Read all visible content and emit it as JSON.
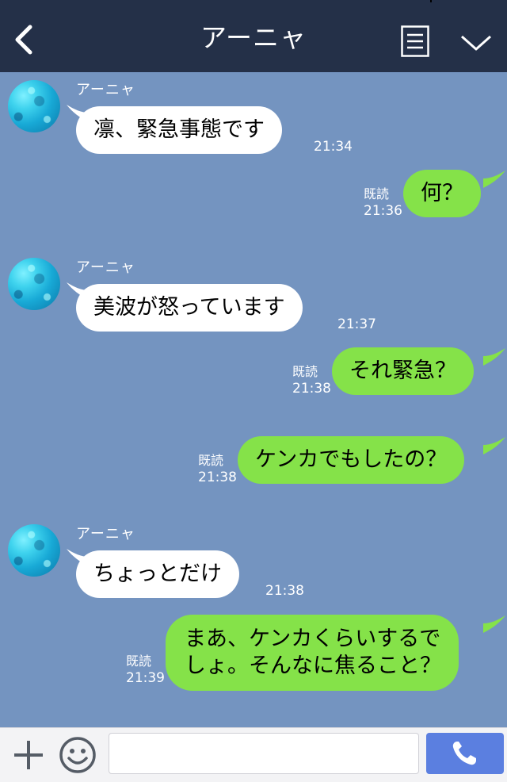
{
  "header": {
    "title": "アーニャ",
    "icons": {
      "back": "chevron-left-icon",
      "menu": "menu-icon",
      "more": "chevron-down-icon"
    }
  },
  "messages": [
    {
      "side": "left",
      "sender": "アーニャ",
      "text": "凛、緊急事態です",
      "time": "21:34"
    },
    {
      "side": "right",
      "text": "何？",
      "read": "既読",
      "time": "21:36"
    },
    {
      "side": "left",
      "sender": "アーニャ",
      "text": "美波が怒っています",
      "time": "21:37"
    },
    {
      "side": "right",
      "text": "それ緊急？",
      "read": "既読",
      "time": "21:38"
    },
    {
      "side": "right",
      "text": "ケンカでもしたの？",
      "read": "既読",
      "time": "21:38"
    },
    {
      "side": "left",
      "sender": "アーニャ",
      "text": "ちょっとだけ",
      "time": "21:38"
    },
    {
      "side": "right",
      "text_lines": [
        "まあ、ケンカくらいするで",
        "しょ。そんなに焦ること？"
      ],
      "read": "既読",
      "time": "21:39"
    }
  ],
  "footer": {
    "icons": {
      "add": "plus-icon",
      "emoji": "smiley-icon",
      "call": "phone-icon"
    },
    "input_value": "",
    "input_placeholder": ""
  },
  "colors": {
    "header_bg": "#243048",
    "chat_bg": "#7494c0",
    "incoming_bubble": "#ffffff",
    "outgoing_bubble": "#85e249",
    "call_button": "#5b7fe0"
  }
}
